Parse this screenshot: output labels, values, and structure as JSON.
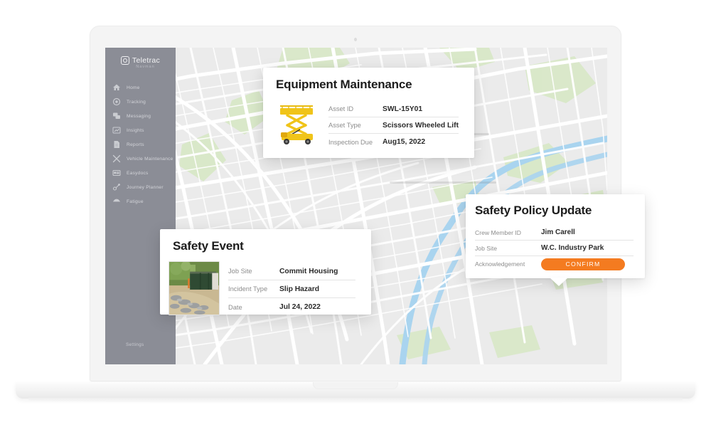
{
  "app": {
    "brand_name": "Teletrac",
    "brand_sub": "Navman"
  },
  "sidebar": {
    "items": [
      {
        "label": "Home",
        "icon": "home-icon"
      },
      {
        "label": "Tracking",
        "icon": "target-icon"
      },
      {
        "label": "Messaging",
        "icon": "chat-bubbles-icon"
      },
      {
        "label": "Insights",
        "icon": "chart-icon"
      },
      {
        "label": "Reports",
        "icon": "document-icon"
      },
      {
        "label": "Vehicle Maintenance",
        "icon": "tools-icon"
      },
      {
        "label": "Easydocs",
        "icon": "card-icon"
      },
      {
        "label": "Journey Planner",
        "icon": "route-icon"
      },
      {
        "label": "Fatigue",
        "icon": "fatigue-icon"
      }
    ],
    "settings_label": "Settings"
  },
  "cards": {
    "equipment": {
      "title": "Equipment Maintenance",
      "thumbnail": "scissor-lift-image",
      "rows": [
        {
          "key": "Asset ID",
          "value": "SWL-15Y01"
        },
        {
          "key": "Asset Type",
          "value": "Scissors Wheeled Lift"
        },
        {
          "key": "Inspection Due",
          "value": "Aug15, 2022"
        }
      ]
    },
    "safety_event": {
      "title": "Safety Event",
      "thumbnail": "construction-site-photo",
      "rows": [
        {
          "key": "Job Site",
          "value": "Commit Housing"
        },
        {
          "key": "Incident Type",
          "value": "Slip Hazard"
        },
        {
          "key": "Date",
          "value": "Jul 24, 2022"
        }
      ]
    },
    "policy": {
      "title": "Safety Policy Update",
      "rows": [
        {
          "key": "Crew Member  ID",
          "value": "Jim Carell"
        },
        {
          "key": "Job Site",
          "value": "W.C. Industry Park"
        }
      ],
      "ack_label": "Acknowledgement",
      "confirm_label": "CONFIRM"
    }
  },
  "colors": {
    "sidebar": "#8b8d96",
    "accent_orange": "#f47b20",
    "map_land": "#ebebeb",
    "map_road": "#ffffff",
    "map_park": "#d9e8c8",
    "map_water": "#a9d4ef",
    "card_bg": "#ffffff"
  }
}
